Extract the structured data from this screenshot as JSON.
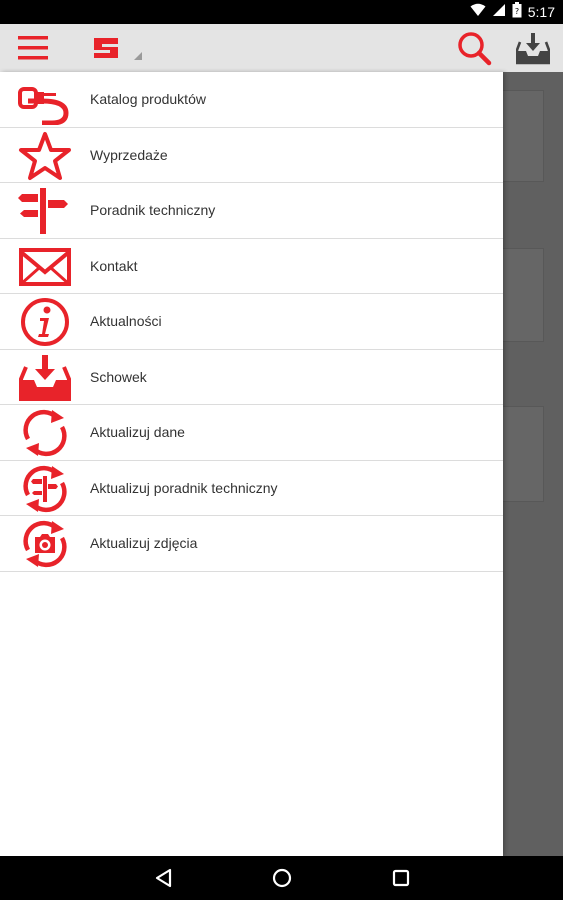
{
  "status_bar": {
    "time": "5:17",
    "icons": [
      "wifi-icon",
      "cell-signal-icon",
      "battery-icon"
    ]
  },
  "app_bar": {
    "menu_icon": "hamburger-menu-icon",
    "logo": "app-logo",
    "actions": [
      "search-icon",
      "inbox-download-icon"
    ]
  },
  "colors": {
    "accent": "#e8232a",
    "app_bar_bg": "#e4e4e4",
    "drawer_bg": "#ffffff",
    "divider": "#dcdcdc",
    "text": "#333333"
  },
  "drawer": {
    "items": [
      {
        "label": "Katalog produktów",
        "icon": "plug-icon"
      },
      {
        "label": "Wyprzedaże",
        "icon": "star-icon"
      },
      {
        "label": "Poradnik techniczny",
        "icon": "signpost-icon"
      },
      {
        "label": "Kontakt",
        "icon": "envelope-icon"
      },
      {
        "label": "Aktualności",
        "icon": "info-icon"
      },
      {
        "label": "Schowek",
        "icon": "inbox-download-icon"
      },
      {
        "label": "Aktualizuj dane",
        "icon": "refresh-icon"
      },
      {
        "label": "Aktualizuj poradnik techniczny",
        "icon": "refresh-signpost-icon"
      },
      {
        "label": "Aktualizuj zdjęcia",
        "icon": "refresh-camera-icon"
      }
    ]
  },
  "nav_bar": {
    "buttons": [
      "back-icon",
      "home-icon",
      "recents-icon"
    ]
  }
}
